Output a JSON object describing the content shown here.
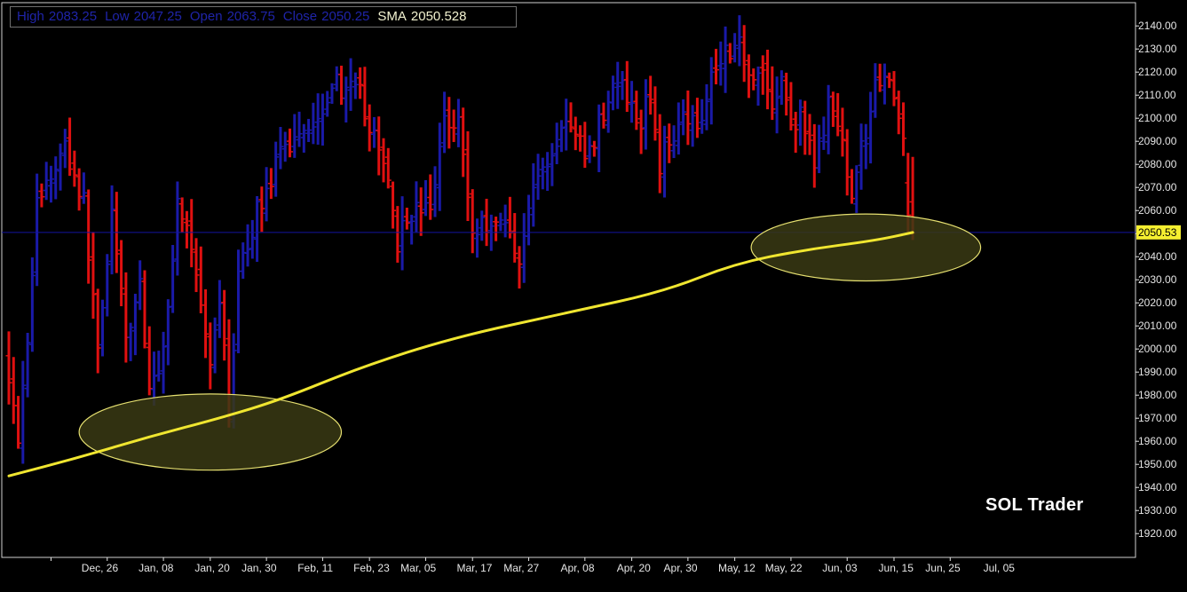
{
  "colors": {
    "background": "#000000",
    "up_bar": "#1a1aa8",
    "down_bar": "#e01010",
    "sma_line": "#f0e630",
    "price_line": "#1414a0",
    "highlight_fill": "#3a3a14",
    "highlight_stroke": "#e6e070",
    "axis_text": "#e6e6e6",
    "price_label_bg": "#f5ef30",
    "price_label_text": "#000000",
    "legend_text": "#1f24a8",
    "legend_sma_text": "#f2f2d0"
  },
  "legend": {
    "high_label": "High",
    "high_value": "2083.25",
    "low_label": "Low",
    "low_value": "2047.25",
    "open_label": "Open",
    "open_value": "2063.75",
    "close_label": "Close",
    "close_value": "2050.25",
    "sma_label": "SMA",
    "sma_value": "2050.528"
  },
  "watermark": "SOL Trader",
  "current_price_label": "2050.53",
  "chart_data": {
    "type": "ohlc",
    "title": "",
    "xlabel": "",
    "ylabel": "",
    "ylim": [
      1911,
      2150
    ],
    "x_tick_labels": [
      "Dec, 26",
      "Jan, 08",
      "Jan, 20",
      "Jan, 30",
      "Feb, 11",
      "Feb, 23",
      "Mar, 05",
      "Mar, 17",
      "Mar, 27",
      "Apr, 08",
      "Apr, 20",
      "Apr, 30",
      "May, 12",
      "May, 22",
      "Jun, 03",
      "Jun, 15",
      "Jun, 25",
      "Jul, 05"
    ],
    "x_tick_bar_index": [
      9,
      21,
      33,
      43,
      55,
      67,
      77,
      89,
      99,
      111,
      123,
      133,
      145,
      155,
      167,
      179,
      189,
      201
    ],
    "y_ticks": [
      1920,
      1930,
      1940,
      1950,
      1960,
      1970,
      1980,
      1990,
      2000,
      2010,
      2020,
      2030,
      2040,
      2050,
      2060,
      2070,
      2080,
      2090,
      2100,
      2110,
      2120,
      2130,
      2140
    ],
    "grid": false,
    "current_price": 2050.53,
    "sma_series": {
      "name": "SMA",
      "points": [
        [
          0,
          1945
        ],
        [
          15,
          1953
        ],
        [
          30,
          1962
        ],
        [
          45,
          1970
        ],
        [
          58,
          1978
        ],
        [
          75,
          1992
        ],
        [
          95,
          2005
        ],
        [
          120,
          2016
        ],
        [
          140,
          2025
        ],
        [
          155,
          2037
        ],
        [
          170,
          2043
        ],
        [
          185,
          2047
        ],
        [
          193,
          2050.5
        ]
      ]
    },
    "highlight_regions": [
      {
        "center_bar": 43,
        "center_price": 1964,
        "bar_halfwidth": 28,
        "price_halfheight": 16.5
      },
      {
        "center_bar": 183,
        "center_price": 2044,
        "bar_halfwidth": 24.5,
        "price_halfheight": 14.5
      }
    ],
    "anchors": [
      [
        0,
        1990
      ],
      [
        2,
        1963
      ],
      [
        4,
        2006
      ],
      [
        6,
        2063
      ],
      [
        9,
        2075
      ],
      [
        12,
        2088
      ],
      [
        16,
        2063
      ],
      [
        19,
        2000
      ],
      [
        22,
        2060
      ],
      [
        25,
        2002
      ],
      [
        28,
        2030
      ],
      [
        30,
        1979
      ],
      [
        33,
        2000
      ],
      [
        36,
        2063
      ],
      [
        38,
        2055
      ],
      [
        40,
        2030
      ],
      [
        43,
        1989
      ],
      [
        45,
        2020
      ],
      [
        47,
        1974
      ],
      [
        49,
        2030
      ],
      [
        53,
        2060
      ],
      [
        58,
        2083
      ],
      [
        62,
        2095
      ],
      [
        66,
        2100
      ],
      [
        69,
        2117
      ],
      [
        71,
        2113
      ],
      [
        75,
        2110
      ],
      [
        78,
        2090
      ],
      [
        81,
        2075
      ],
      [
        83,
        2047
      ],
      [
        86,
        2060
      ],
      [
        90,
        2060
      ],
      [
        93,
        2100
      ],
      [
        96,
        2100
      ],
      [
        99,
        2050
      ],
      [
        102,
        2055
      ],
      [
        106,
        2055
      ],
      [
        109,
        2040
      ],
      [
        112,
        2070
      ],
      [
        116,
        2085
      ],
      [
        119,
        2100
      ],
      [
        121,
        2090
      ],
      [
        124,
        2085
      ],
      [
        128,
        2110
      ],
      [
        131,
        2115
      ],
      [
        134,
        2095
      ],
      [
        137,
        2110
      ],
      [
        139,
        2080
      ],
      [
        141,
        2090
      ],
      [
        144,
        2105
      ],
      [
        147,
        2095
      ],
      [
        150,
        2120
      ],
      [
        153,
        2130
      ],
      [
        156,
        2132
      ],
      [
        158,
        2121
      ],
      [
        161,
        2120
      ],
      [
        163,
        2105
      ],
      [
        165,
        2115
      ],
      [
        167,
        2098
      ],
      [
        169,
        2100
      ],
      [
        172,
        2080
      ],
      [
        175,
        2105
      ],
      [
        177,
        2095
      ],
      [
        180,
        2070
      ],
      [
        183,
        2093
      ],
      [
        185,
        2118
      ],
      [
        187,
        2119
      ],
      [
        189,
        2106
      ],
      [
        191,
        2092
      ],
      [
        192,
        2060
      ],
      [
        193,
        2050.25
      ]
    ],
    "last_bars": [
      {
        "i": 192,
        "open": 2072,
        "high": 2085,
        "low": 2050,
        "close": 2058
      },
      {
        "i": 193,
        "open": 2063.75,
        "high": 2083.25,
        "low": 2047.25,
        "close": 2050.25
      }
    ]
  }
}
